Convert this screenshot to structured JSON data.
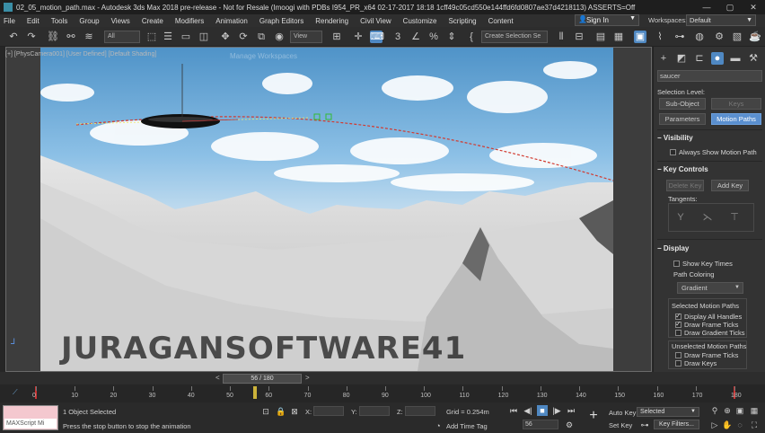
{
  "window": {
    "title": "02_05_motion_path.max - Autodesk 3ds Max 2018 pre-release - Not for Resale (Imoogi with PDBs I954_PR_x64 02-17-2017 18:18 1cff49c05cd550e144ffd6fd0807ae37d4218113) ASSERTS=Off",
    "minimize": "—",
    "maximize": "▢",
    "close": "✕"
  },
  "menu": [
    "File",
    "Edit",
    "Tools",
    "Group",
    "Views",
    "Create",
    "Modifiers",
    "Animation",
    "Graph Editors",
    "Rendering",
    "Civil View",
    "Customize",
    "Scripting",
    "Content"
  ],
  "account": {
    "sign_in": "Sign In",
    "workspaces_label": "Workspaces:",
    "workspace_value": "Default"
  },
  "toolbar": {
    "selection_filter": "All",
    "coord_system": "View",
    "selection_set": "Create Selection Se"
  },
  "viewport": {
    "label": "[+] [PhysCamera001] [User Defined] [Default Shading]",
    "watermark": "JURAGANSOFTWARE41",
    "ghost_dialog": "Manage Workspaces"
  },
  "command_panel": {
    "object_name": "saucer",
    "selection_level_label": "Selection Level:",
    "sub_object": "Sub-Object",
    "keys_dropdown": "Keys",
    "parameters_button": "Parameters",
    "motion_paths_button": "Motion Paths",
    "visibility_header": "Visibility",
    "always_show": "Always Show Motion Path",
    "key_controls_header": "Key Controls",
    "delete_key": "Delete Key",
    "add_key": "Add Key",
    "tangents_label": "Tangents:",
    "display_header": "Display",
    "show_key_times": "Show Key Times",
    "path_coloring_label": "Path Coloring",
    "path_coloring_value": "Gradient",
    "selected_paths_label": "Selected Motion Paths",
    "display_all_handles": "Display All Handles",
    "draw_frame_ticks": "Draw Frame Ticks",
    "draw_gradient_ticks": "Draw Gradient Ticks",
    "unselected_paths_label": "Unselected Motion Paths",
    "unsel_draw_frame_ticks": "Draw Frame Ticks",
    "unsel_draw_keys": "Draw Keys"
  },
  "timeline": {
    "slider_text": "56 / 180",
    "ticks": [
      "0",
      "10",
      "20",
      "30",
      "40",
      "50",
      "60",
      "70",
      "80",
      "90",
      "100",
      "110",
      "120",
      "130",
      "140",
      "150",
      "160",
      "170",
      "180"
    ]
  },
  "status": {
    "maxscript_label": "MAXScript Mi",
    "selected_text": "1 Object Selected",
    "prompt": "Press the stop button to stop the animation",
    "x_label": "X:",
    "y_label": "Y:",
    "z_label": "Z:",
    "grid": "Grid = 0.254m",
    "add_time_tag": "Add Time Tag",
    "auto_key": "Auto Key",
    "set_key": "Set Key",
    "key_mode": "Selected",
    "key_filters": "Key Filters...",
    "current_frame": "56"
  }
}
